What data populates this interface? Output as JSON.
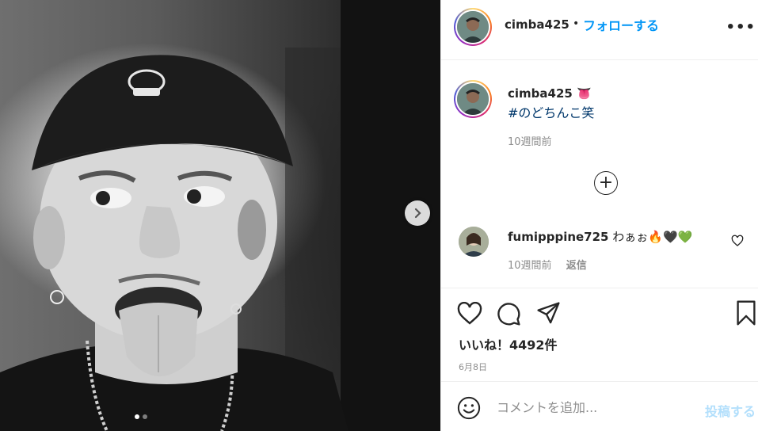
{
  "post": {
    "username": "cimba425",
    "separator": "•",
    "follow_label": "フォローする",
    "more_label": "•••",
    "caption_username": "cimba425",
    "caption_emoji": "👅",
    "hashtag": "#のどちんこ笑",
    "caption_time": "10週間前",
    "carousel": {
      "current": 1,
      "total": 2
    }
  },
  "comments": [
    {
      "username": "fumipppine725",
      "text": "わぁぉ🔥🖤💚",
      "time": "10週間前",
      "reply_label": "返信"
    }
  ],
  "actions": {
    "likes_text": "いいね！4492件",
    "date": "6月8日"
  },
  "add_comment": {
    "placeholder": "コメントを追加...",
    "post_label": "投稿する"
  },
  "icons": {
    "next": "chevron-right-icon",
    "more": "more-options-icon",
    "load_more": "plus-circle-icon",
    "like": "heart-icon",
    "comment": "comment-bubble-icon",
    "share": "paper-plane-icon",
    "save": "bookmark-icon",
    "emoji": "smiley-icon"
  },
  "colors": {
    "accent": "#0095f6",
    "hashtag": "#00376b",
    "muted": "#8e8e8e",
    "post_disabled": "#b2dffc"
  }
}
